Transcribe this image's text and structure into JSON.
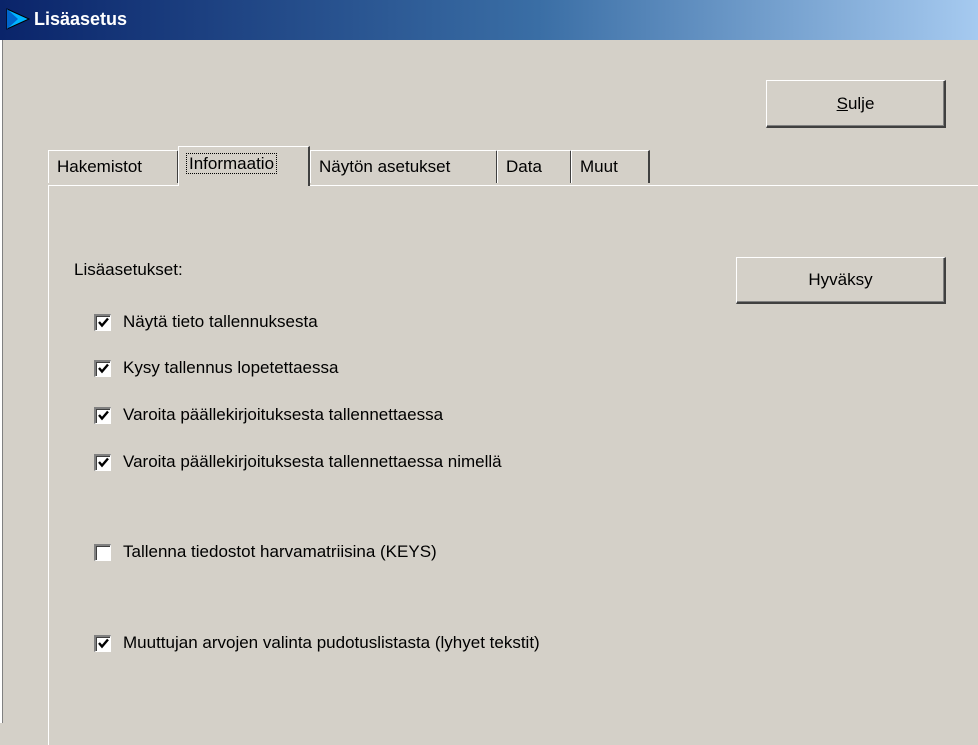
{
  "window": {
    "title": "Lisäasetus"
  },
  "buttons": {
    "close_label": "Sulje",
    "accept_label": "Hyväksy"
  },
  "tabs": [
    {
      "label": "Hakemistot",
      "active": false
    },
    {
      "label": "Informaatio",
      "active": true
    },
    {
      "label": "Näytön asetukset",
      "active": false
    },
    {
      "label": "Data",
      "active": false
    },
    {
      "label": "Muut",
      "active": false
    }
  ],
  "settings": {
    "section_label": "Lisäasetukset:",
    "options": [
      {
        "label": "Näytä tieto tallennuksesta",
        "checked": true
      },
      {
        "label": "Kysy tallennus lopetettaessa",
        "checked": true
      },
      {
        "label": "Varoita päällekirjoituksesta tallennettaessa",
        "checked": true
      },
      {
        "label": "Varoita päällekirjoituksesta tallennettaessa nimellä",
        "checked": true
      },
      {
        "label": "Tallenna tiedostot harvamatriisina (KEYS)",
        "checked": false
      },
      {
        "label": "Muuttujan arvojen valinta pudotuslistasta (lyhyet tekstit)",
        "checked": true
      }
    ]
  },
  "colors": {
    "titlebar_start": "#0a246a",
    "titlebar_end": "#a6caf0",
    "face": "#d4d0c8",
    "app_icon": "#00a0e0"
  },
  "icons": {
    "app": "blue-flag-icon",
    "check": "checkmark-icon"
  }
}
